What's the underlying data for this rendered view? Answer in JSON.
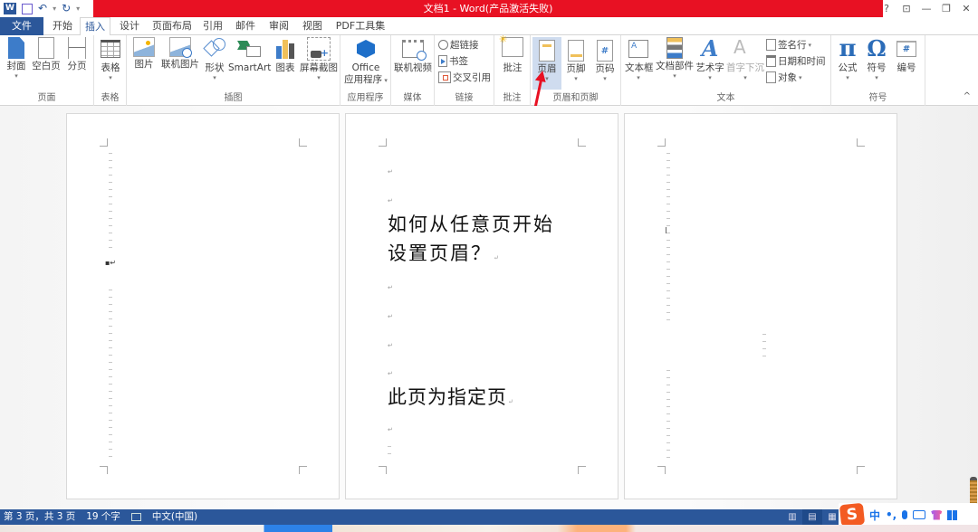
{
  "window": {
    "title": "文档1 - Word(产品激活失败)",
    "controls": {
      "help": "?",
      "ribbon_display": "⊡",
      "minimize": "—",
      "restore": "❐",
      "close": "✕"
    }
  },
  "quick_access": {
    "save": "💾",
    "undo": "↶",
    "undo_dd": "▾",
    "redo": "↻",
    "customize": "▾",
    "app_logo": "W"
  },
  "tabs": [
    {
      "label": "文件"
    },
    {
      "label": "开始"
    },
    {
      "label": "插入",
      "active": true
    },
    {
      "label": "设计"
    },
    {
      "label": "页面布局"
    },
    {
      "label": "引用"
    },
    {
      "label": "邮件"
    },
    {
      "label": "审阅"
    },
    {
      "label": "视图"
    },
    {
      "label": "PDF工具集"
    }
  ],
  "ribbon": {
    "groups": {
      "pages": {
        "label": "页面",
        "buttons": [
          "封面",
          "空白页",
          "分页"
        ]
      },
      "tables": {
        "label": "表格",
        "buttons": [
          "表格"
        ]
      },
      "illustrations": {
        "label": "插图",
        "buttons": [
          "图片",
          "联机图片",
          "形状",
          "SmartArt",
          "图表",
          "屏幕截图"
        ]
      },
      "apps": {
        "label": "应用程序",
        "button_line1": "Office",
        "button_line2": "应用程序"
      },
      "media": {
        "label": "媒体",
        "buttons": [
          "联机视频"
        ]
      },
      "links": {
        "label": "链接",
        "buttons": [
          "超链接",
          "书签",
          "交叉引用"
        ]
      },
      "comments": {
        "label": "批注",
        "buttons": [
          "批注"
        ]
      },
      "header_footer": {
        "label": "页眉和页脚",
        "buttons": [
          "页眉",
          "页脚",
          "页码"
        ]
      },
      "text": {
        "label": "文本",
        "buttons": [
          "文本框",
          "文档部件",
          "艺术字",
          "首字下沉"
        ],
        "small_buttons": [
          "签名行",
          "日期和时间",
          "对象"
        ]
      },
      "symbols": {
        "label": "符号",
        "buttons": [
          "公式",
          "符号",
          "编号"
        ]
      }
    },
    "collapse": "^"
  },
  "document": {
    "page2": {
      "title_line1": "如何从任意页开始",
      "title_line2": "设置页眉？",
      "body": "此页为指定页"
    },
    "paragraph_mark": "↵"
  },
  "statusbar": {
    "page_info": "第 3 页，共 3 页",
    "word_count": "19 个字",
    "proofing_icon": "📖",
    "language": "中文(中国)",
    "views": [
      "read-mode",
      "print-layout",
      "web-layout"
    ],
    "active_view": "print-layout"
  },
  "ime": {
    "logo": "S",
    "mode": "中",
    "punct": "•,",
    "mic": "🎤",
    "keyboard": "⌨",
    "skin": "👕",
    "menu": "▦"
  }
}
